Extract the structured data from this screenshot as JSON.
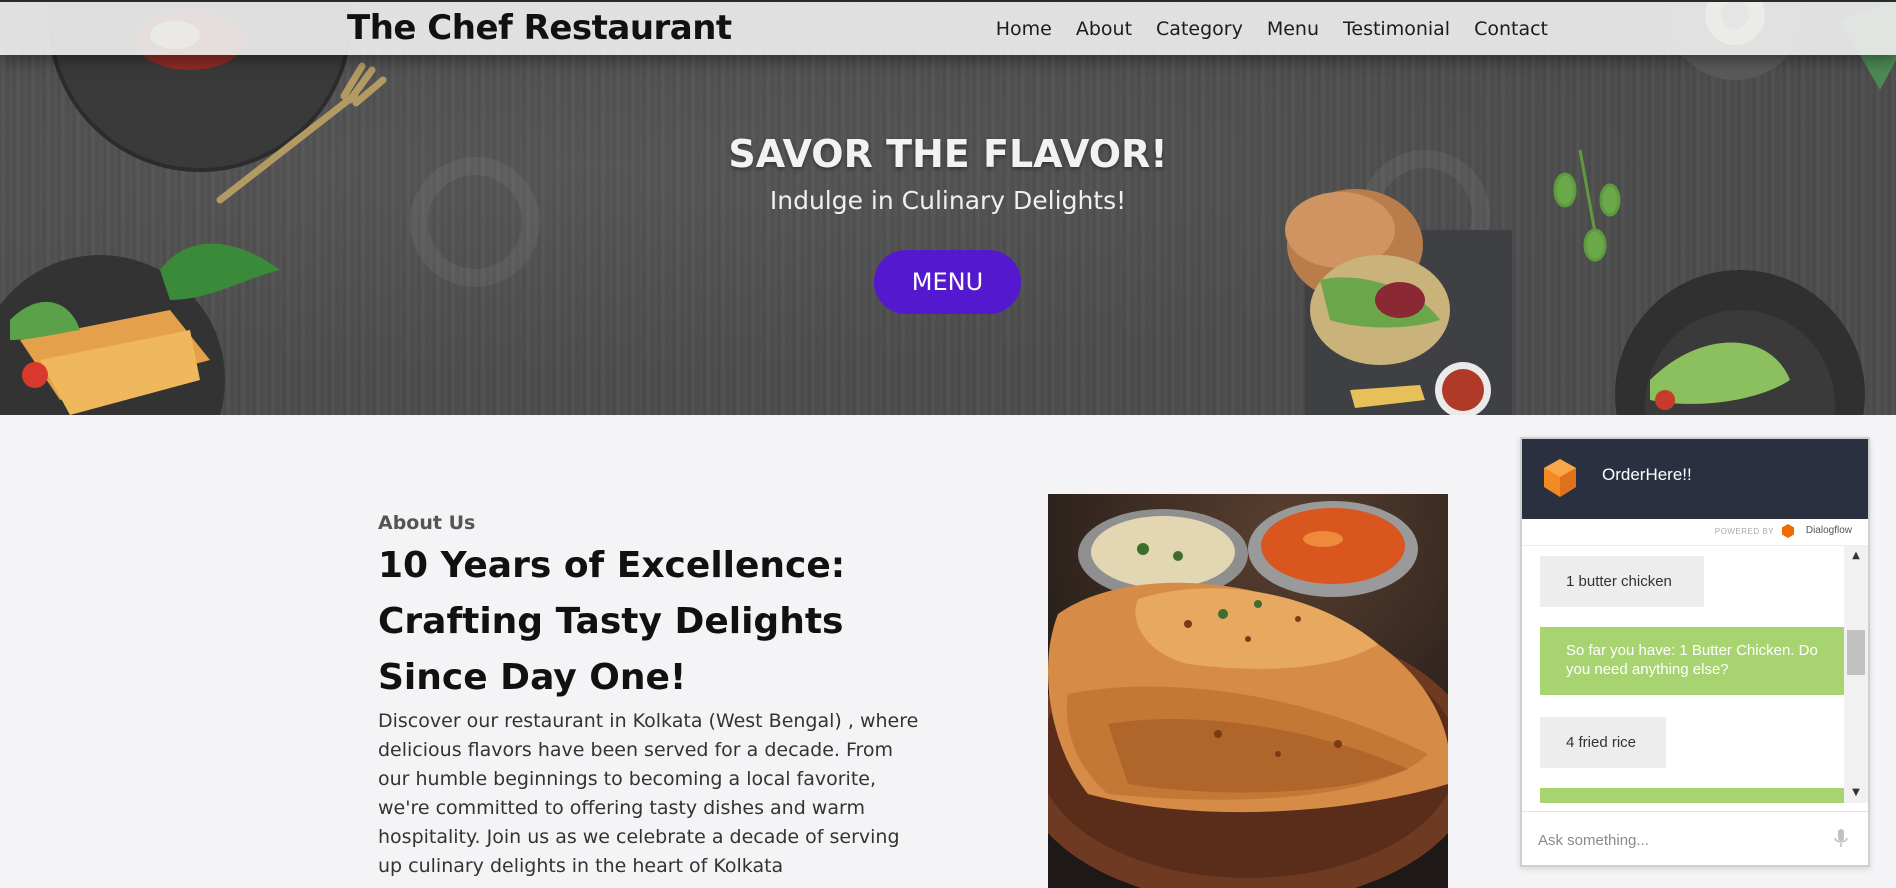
{
  "header": {
    "brand": "The Chef Restaurant",
    "nav": [
      "Home",
      "About",
      "Category",
      "Menu",
      "Testimonial",
      "Contact"
    ]
  },
  "hero": {
    "title": "SAVOR THE FLAVOR!",
    "subtitle": "Indulge in Culinary Delights!",
    "button_label": "MENU",
    "button_color": "#5418cf"
  },
  "about": {
    "kicker": "About Us",
    "title": "10 Years of Excellence: Crafting Tasty Delights Since Day One!",
    "text": "Discover our restaurant in Kolkata (West Bengal) , where delicious flavors have been served for a decade. From our humble beginnings to becoming a local favorite, we're committed to offering tasty dishes and warm hospitality. Join us as we celebrate a decade of serving up culinary delights in the heart of Kolkata"
  },
  "chat": {
    "title": "OrderHere!!",
    "powered_by": "POWERED BY",
    "powered_brand": "Dialogflow",
    "messages": [
      {
        "from": "user",
        "text": "1 butter chicken"
      },
      {
        "from": "bot",
        "text": "So far you have: 1 Butter Chicken. Do you need anything else?"
      },
      {
        "from": "user",
        "text": "4 fried rice"
      },
      {
        "from": "bot",
        "text": ""
      }
    ],
    "input_placeholder": "Ask something...",
    "user_bubble_color": "#ededed",
    "bot_bubble_color": "#a7d470",
    "header_color": "#2a303f"
  }
}
